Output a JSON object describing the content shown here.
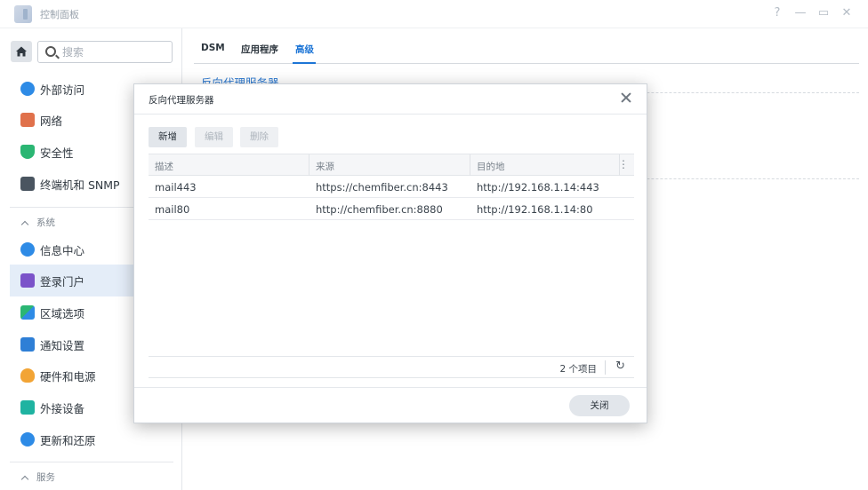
{
  "window": {
    "title": "控制面板",
    "controls": [
      "?",
      "—",
      "▭",
      "✕"
    ]
  },
  "sidebar": {
    "search_placeholder": "搜索",
    "items": [
      {
        "label": "外部访问",
        "icon": "globe-link-icon",
        "color": "#2e8be6"
      },
      {
        "label": "网络",
        "icon": "house-network-icon",
        "color": "#e0714b"
      },
      {
        "label": "安全性",
        "icon": "shield-check-icon",
        "color": "#2bb673"
      },
      {
        "label": "终端机和 SNMP",
        "icon": "terminal-icon",
        "color": "#4a5560"
      }
    ],
    "section_system": "系统",
    "system_items": [
      {
        "label": "信息中心",
        "icon": "info-icon",
        "color": "#2e8be6"
      },
      {
        "label": "登录门户",
        "icon": "login-portal-icon",
        "color": "#7b53c9",
        "active": true
      },
      {
        "label": "区域选项",
        "icon": "region-icon",
        "color": "#2bb673"
      },
      {
        "label": "通知设置",
        "icon": "notification-icon",
        "color": "#2e7fd6"
      },
      {
        "label": "硬件和电源",
        "icon": "bulb-icon",
        "color": "#f2a435"
      },
      {
        "label": "外接设备",
        "icon": "external-device-icon",
        "color": "#1fb3a1"
      },
      {
        "label": "更新和还原",
        "icon": "update-restore-icon",
        "color": "#2e8be6"
      }
    ],
    "section_services": "服务"
  },
  "main": {
    "tabs": [
      "DSM",
      "应用程序",
      "高级"
    ],
    "active_tab": "高级",
    "section_link": "反向代理服务器"
  },
  "dialog": {
    "title": "反向代理服务器",
    "toolbar": {
      "add": "新增",
      "edit": "编辑",
      "delete": "删除"
    },
    "columns": [
      "描述",
      "来源",
      "目的地"
    ],
    "rows": [
      {
        "description": "mail443",
        "source": "https://chemfiber.cn:8443",
        "destination": "http://192.168.1.14:443"
      },
      {
        "description": "mail80",
        "source": "http://chemfiber.cn:8880",
        "destination": "http://192.168.1.14:80"
      }
    ],
    "item_count": "2 个项目",
    "close_label": "关闭"
  },
  "colors": {
    "accent": "#1d75d6",
    "active_nav_bg": "#e4edf8"
  }
}
